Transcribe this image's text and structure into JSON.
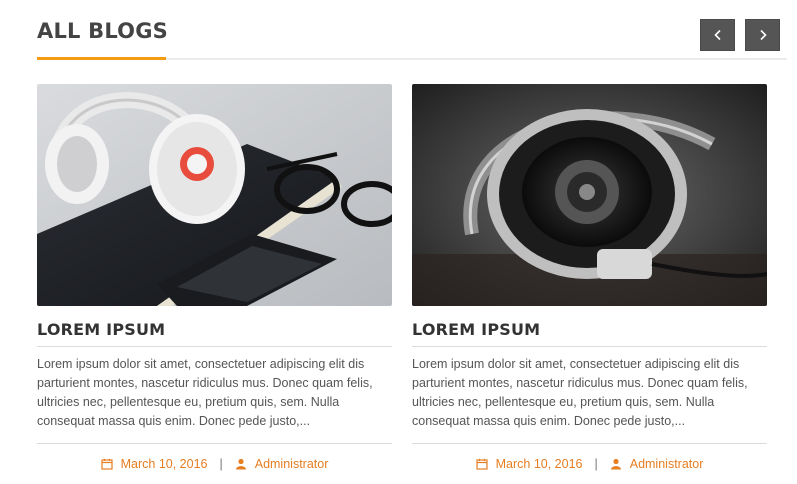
{
  "section": {
    "title": "ALL BLOGS"
  },
  "colors": {
    "accent": "#f39c12",
    "meta": "#e67e22",
    "nav_button": "#555555"
  },
  "navigation": {
    "prev_icon": "chevron-left-icon",
    "next_icon": "chevron-right-icon"
  },
  "posts": [
    {
      "image": "headphones-notebook-phone-photo",
      "title": "LOREM IPSUM",
      "excerpt": "Lorem ipsum dolor sit amet, consectetuer adipiscing elit dis parturient montes, nascetur ridiculus mus. Donec quam felis, ultricies nec, pellentesque eu, pretium quis, sem. Nulla consequat massa quis enim. Donec pede justo,...",
      "date": "March 10, 2016",
      "author": "Administrator",
      "date_icon": "calendar-icon",
      "author_icon": "user-icon"
    },
    {
      "image": "studio-headphones-photo",
      "title": "LOREM IPSUM",
      "excerpt": "Lorem ipsum dolor sit amet, consectetuer adipiscing elit dis parturient montes, nascetur ridiculus mus. Donec quam felis, ultricies nec, pellentesque eu, pretium quis, sem. Nulla consequat massa quis enim. Donec pede justo,...",
      "date": "March 10, 2016",
      "author": "Administrator",
      "date_icon": "calendar-icon",
      "author_icon": "user-icon"
    }
  ],
  "separator": "|"
}
